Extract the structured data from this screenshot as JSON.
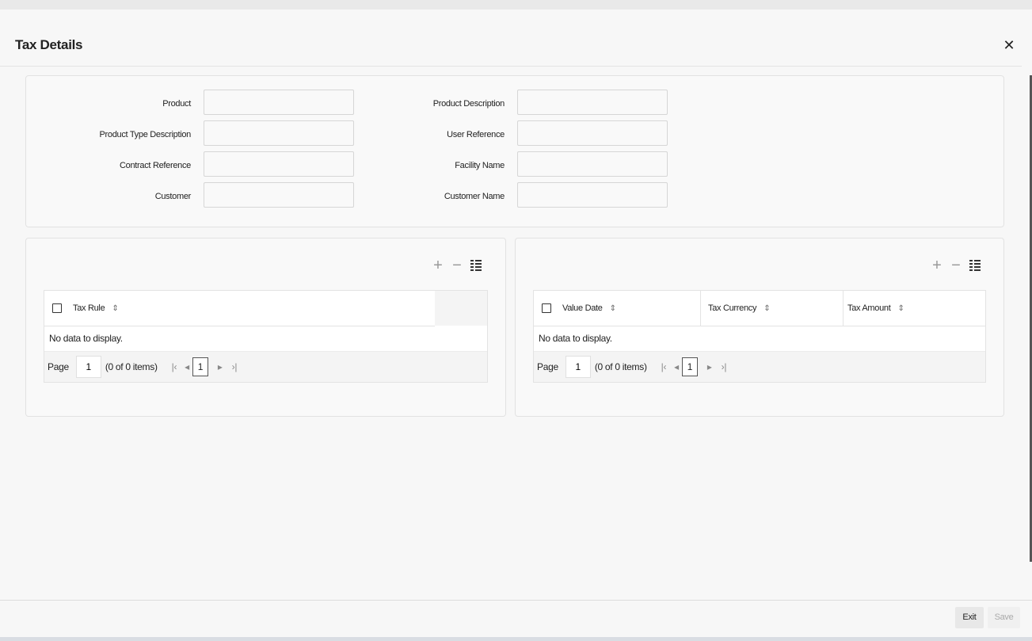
{
  "window": {
    "title": "Tax Details",
    "close_icon": "close-icon"
  },
  "form": {
    "product_label": "Product",
    "product_value": "",
    "product_desc_label": "Product Description",
    "product_desc_value": "",
    "product_type_desc_label": "Product Type Description",
    "product_type_desc_value": "",
    "user_ref_label": "User Reference",
    "user_ref_value": "",
    "contract_ref_label": "Contract Reference",
    "contract_ref_value": "",
    "facility_name_label": "Facility Name",
    "facility_name_value": "",
    "customer_label": "Customer",
    "customer_value": "",
    "customer_name_label": "Customer Name",
    "customer_name_value": ""
  },
  "left_grid": {
    "toolbar_icons": [
      "add-icon",
      "remove-icon",
      "single-record-view-icon"
    ],
    "columns": [
      "Tax Rule"
    ],
    "empty_text": "No data to display.",
    "pager": {
      "page_label": "Page",
      "page_value": "1",
      "items_text": "(0 of 0 items)",
      "current_page": "1"
    }
  },
  "right_grid": {
    "toolbar_icons": [
      "add-icon",
      "remove-icon",
      "single-record-view-icon"
    ],
    "columns": [
      "Value Date",
      "Tax Currency",
      "Tax Amount"
    ],
    "empty_text": "No data to display.",
    "pager": {
      "page_label": "Page",
      "page_value": "1",
      "items_text": "(0 of 0 items)",
      "current_page": "1"
    }
  },
  "footer": {
    "exit_label": "Exit",
    "save_label": "Save"
  }
}
